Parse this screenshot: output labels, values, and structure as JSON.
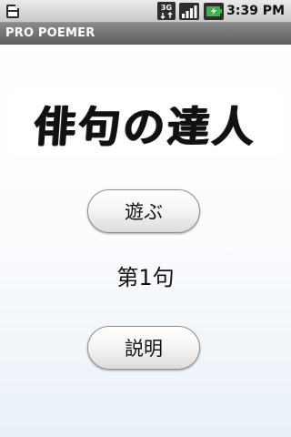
{
  "status_bar": {
    "time": "3:39 PM",
    "network": "3G",
    "icons": [
      "sd-card-icon",
      "3g-data-icon",
      "signal-strength-icon",
      "battery-charging-icon"
    ],
    "accent_color": "#3cb64a"
  },
  "app": {
    "title": "PRO POEMER"
  },
  "main": {
    "logo_text": "俳句の達人",
    "play_button": "遊ぶ",
    "round_label": "第1句",
    "help_button": "説明"
  }
}
